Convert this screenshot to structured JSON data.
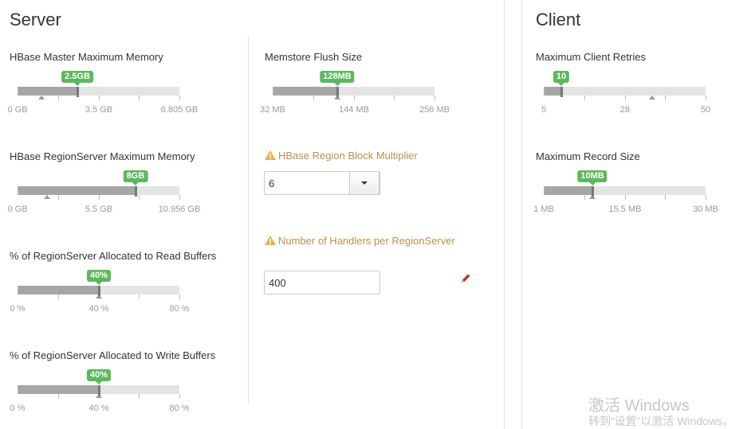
{
  "server": {
    "title": "Server",
    "sliders": [
      {
        "label": "HBase Master Maximum Memory",
        "value": "2.5GB",
        "fraction": 0.37,
        "default_fraction": 0.15,
        "ticks": [
          "0 GB",
          "3.5 GB",
          "6.805 GB"
        ]
      },
      {
        "label": "HBase RegionServer Maximum Memory",
        "value": "8GB",
        "fraction": 0.73,
        "default_fraction": 0.18,
        "ticks": [
          "0 GB",
          "5.5 GB",
          "10.956 GB"
        ]
      },
      {
        "label": "% of RegionServer Allocated to Read Buffers",
        "value": "40%",
        "fraction": 0.5,
        "default_fraction": 0.5,
        "ticks": [
          "0 %",
          "40 %",
          "80 %"
        ]
      },
      {
        "label": "% of RegionServer Allocated to Write Buffers",
        "value": "40%",
        "fraction": 0.5,
        "default_fraction": 0.5,
        "ticks": [
          "0 %",
          "40 %",
          "80 %"
        ]
      }
    ],
    "memstore": {
      "label": "Memstore Flush Size",
      "value": "128MB",
      "fraction": 0.4,
      "default_fraction": 0.4,
      "ticks": [
        "32 MB",
        "144 MB",
        "256 MB"
      ]
    },
    "block_multiplier": {
      "label": "HBase Region Block Multiplier",
      "value": "6"
    },
    "handlers": {
      "label": "Number of Handlers per RegionServer",
      "value": "400"
    }
  },
  "client": {
    "title": "Client",
    "sliders": [
      {
        "label": "Maximum Client Retries",
        "value": "10",
        "fraction": 0.11,
        "default_fraction": 0.67,
        "ticks": [
          "5",
          "28",
          "50"
        ]
      },
      {
        "label": "Maximum Record Size",
        "value": "10MB",
        "fraction": 0.3,
        "default_fraction": 0.3,
        "ticks": [
          "1 MB",
          "15.5 MB",
          "30 MB"
        ]
      }
    ]
  },
  "colors": {
    "badge": "#5cb85c",
    "warning": "#b88f4e",
    "edit_icon": "#c9302c"
  },
  "icons": {
    "warning": "warning-triangle-icon",
    "edit": "pencil-icon",
    "dropdown": "caret-down-icon"
  },
  "watermark": {
    "line1": "激活 Windows",
    "line2": "转到“设置”以激活 Windows。"
  }
}
